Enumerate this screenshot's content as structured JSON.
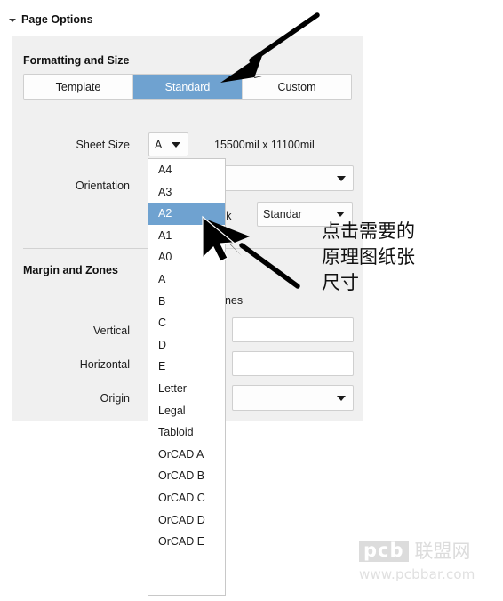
{
  "section": {
    "title": "Page Options",
    "collapse_icon": "triangle-collapse-icon"
  },
  "formatting": {
    "group_title": "Formatting and Size",
    "tabs": [
      {
        "label": "Template",
        "active": false
      },
      {
        "label": "Standard",
        "active": true
      },
      {
        "label": "Custom",
        "active": false
      }
    ],
    "sheet_size": {
      "label": "Sheet Size",
      "value": "A",
      "dimensions": "15500mil x 11100mil"
    },
    "orientation": {
      "label": "Orientation",
      "value": ""
    },
    "title_block": {
      "label": "ck",
      "value": "Standar"
    }
  },
  "margin_zones": {
    "group_title": "Margin and Zones",
    "show_zones_label": "ones",
    "vertical": {
      "label": "Vertical",
      "value": ""
    },
    "horizontal": {
      "label": "Horizontal",
      "value": ""
    },
    "origin": {
      "label": "Origin",
      "value": ""
    }
  },
  "dropdown": {
    "name": "sheet-size-dropdown",
    "selected": "A2",
    "items": [
      "A4",
      "A3",
      "A2",
      "A1",
      "A0",
      "A",
      "B",
      "C",
      "D",
      "E",
      "Letter",
      "Legal",
      "Tabloid",
      "OrCAD A",
      "OrCAD B",
      "OrCAD C",
      "OrCAD D",
      "OrCAD E"
    ]
  },
  "annotations": {
    "chinese_note_lines": [
      "点击需要的",
      "原理图纸张",
      "尺寸"
    ],
    "arrow_to_standard_tab": "arrow-pointing-to-standard-tab",
    "arrow_to_a2_item": "arrow-pointing-to-a2-item",
    "cursor": "mouse-pointer-cursor"
  },
  "watermark": {
    "logo_text": "pcb",
    "site_cn": "联盟网",
    "url": "www.pcbbar.com"
  },
  "colors": {
    "accent_blue": "#6fa2d0",
    "panel_bg": "#f0f0f0",
    "page_bg": "#ffffff",
    "border": "#cfcfcf",
    "text": "#1b1b1b"
  }
}
